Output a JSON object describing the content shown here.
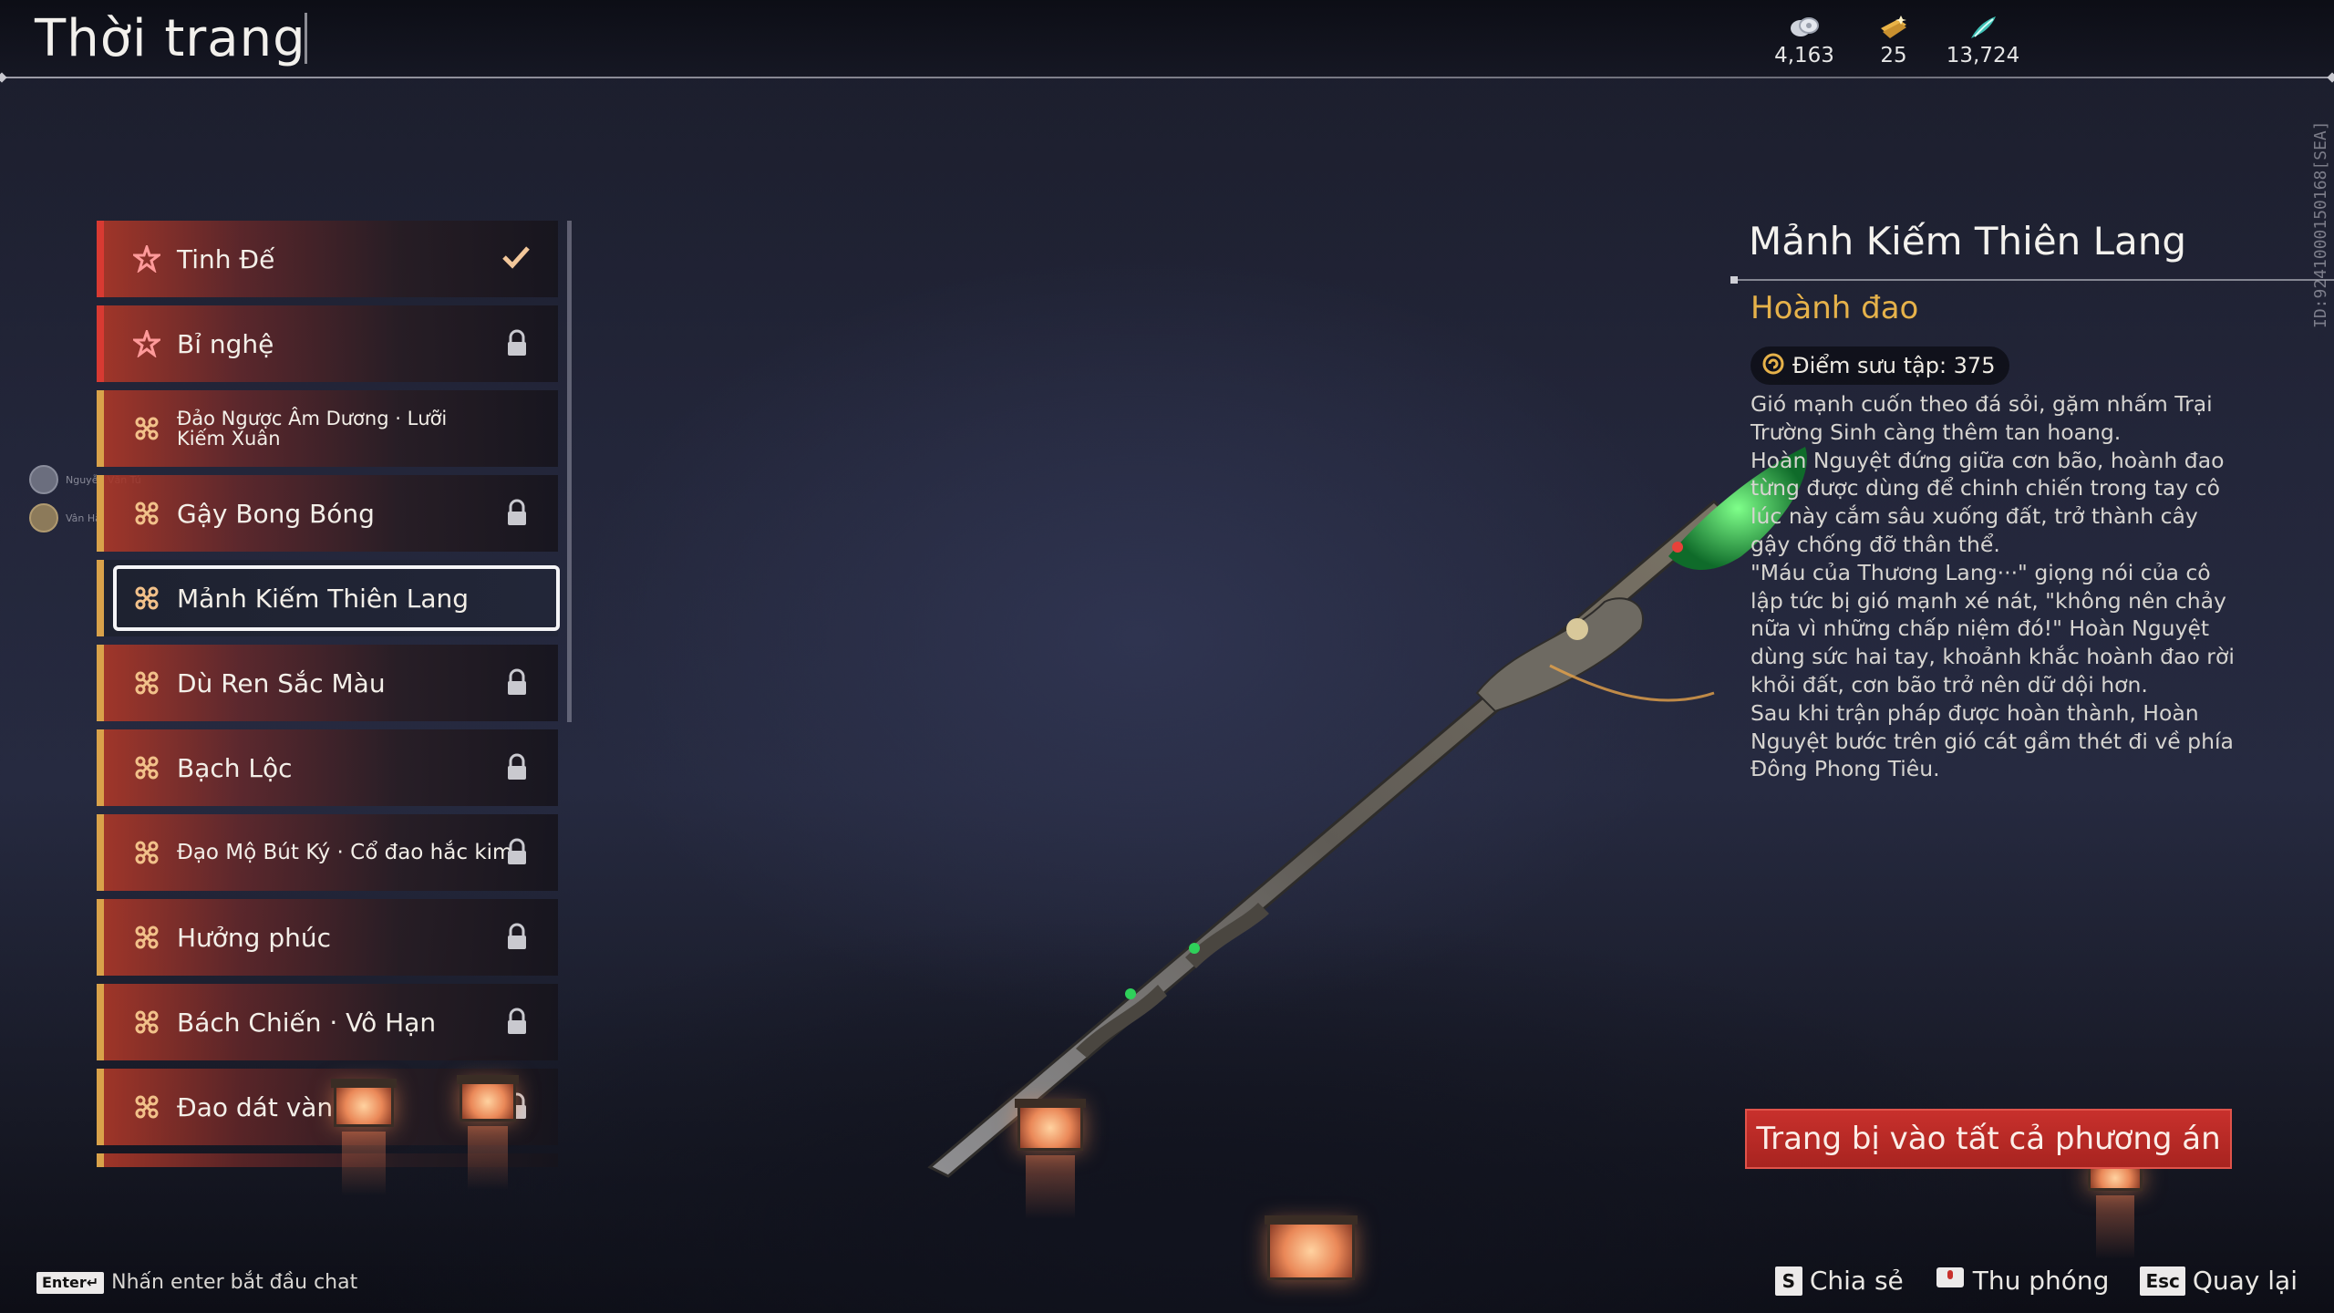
{
  "header": {
    "title": "Thời trang",
    "currencies": [
      {
        "icon": "coin-stack-icon",
        "value": "4,163"
      },
      {
        "icon": "gold-ticket-icon",
        "value": "25"
      },
      {
        "icon": "jade-feather-icon",
        "value": "13,724"
      }
    ],
    "vertical_id": "ID:9241000150168[SEA]"
  },
  "side_avatars": [
    {
      "name": "Nguyễn Văn Tú"
    },
    {
      "name": "Vân Hà"
    }
  ],
  "list": {
    "items": [
      {
        "label": "Tinh Đế",
        "rarity": "red",
        "status": "equipped"
      },
      {
        "label": "Bỉ nghệ",
        "rarity": "red",
        "status": "locked"
      },
      {
        "label": "Đảo Ngược Âm Dương · Lưỡi Kiếm Xuân",
        "rarity": "gold",
        "status": "none"
      },
      {
        "label": "Gậy Bong Bóng",
        "rarity": "gold",
        "status": "locked"
      },
      {
        "label": "Mảnh Kiếm Thiên Lang",
        "rarity": "gold",
        "status": "selected"
      },
      {
        "label": "Dù Ren Sắc Màu",
        "rarity": "gold",
        "status": "locked"
      },
      {
        "label": "Bạch Lộc",
        "rarity": "gold",
        "status": "locked"
      },
      {
        "label": "Đạo Mộ Bút Ký · Cổ đao hắc kim",
        "rarity": "gold",
        "status": "locked"
      },
      {
        "label": "Hưởng phúc",
        "rarity": "gold",
        "status": "locked"
      },
      {
        "label": "Bách Chiến · Vô Hạn",
        "rarity": "gold",
        "status": "locked"
      },
      {
        "label": "Đao dát vàng",
        "rarity": "gold",
        "status": "locked"
      }
    ]
  },
  "detail": {
    "name": "Mảnh Kiếm Thiên Lang",
    "type": "Hoành đao",
    "points_label": "Điểm sưu tập: 375",
    "description": [
      "Gió mạnh cuốn theo đá sỏi, gặm nhấm Trại Trường Sinh càng thêm tan hoang.",
      "Hoàn Nguyệt đứng giữa cơn bão, hoành đao từng được dùng để chinh chiến trong tay cô lúc này cắm sâu xuống đất, trở thành cây gậy chống đỡ thân thể.",
      "\"Máu của Thương Lang···\" giọng nói của cô lập tức bị gió mạnh xé nát, \"không nên chảy nữa vì những chấp niệm đó!\" Hoàn Nguyệt dùng sức hai tay, khoảnh khắc hoành đao rời khỏi đất, cơn bão trở nên dữ dội hơn.",
      "Sau khi trận pháp được hoàn thành, Hoàn Nguyệt bước trên gió cát gầm thét đi về phía Đông Phong Tiêu."
    ],
    "equip_button": "Trang bị vào tất cả phương án"
  },
  "footer": {
    "chat_key": "Enter↵",
    "chat_hint": "Nhấn enter bắt đầu chat",
    "actions": [
      {
        "key": "S",
        "label": "Chia sẻ"
      },
      {
        "key": "",
        "label": "Thu phóng"
      },
      {
        "key": "Esc",
        "label": "Quay lại"
      }
    ]
  },
  "colors": {
    "accent_red": "#c8302c",
    "rarity_gold": "#d9a24a",
    "rarity_red": "#d83a32",
    "type_gold": "#e6b24a"
  }
}
